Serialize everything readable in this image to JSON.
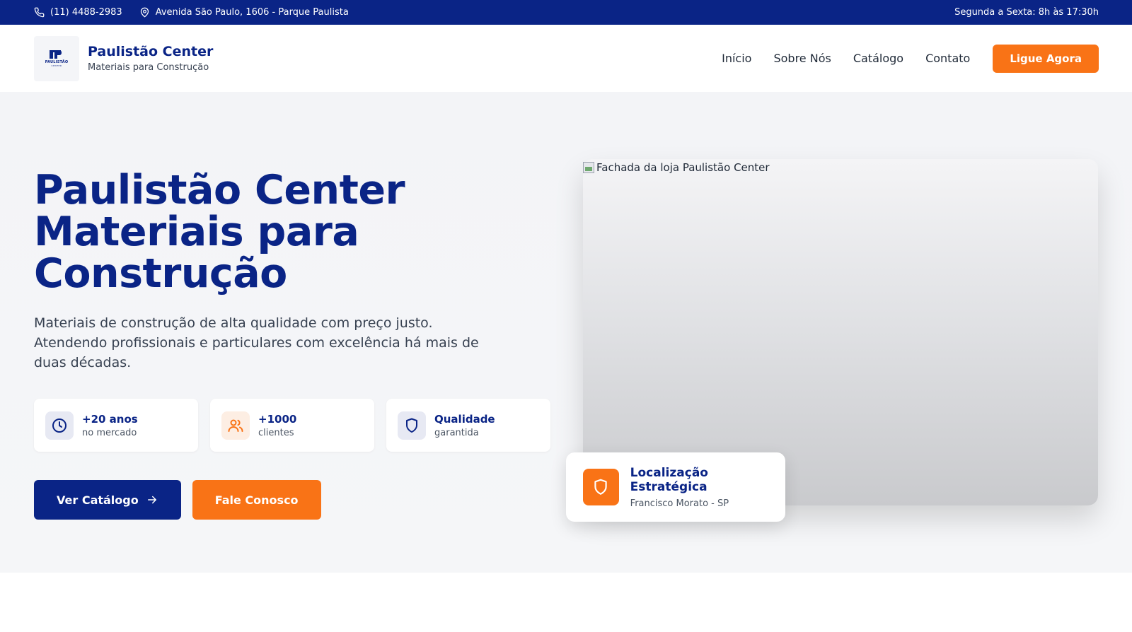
{
  "topbar": {
    "phone": "(11) 4488-2983",
    "address": "Avenida São Paulo, 1606 - Parque Paulista",
    "hours": "Segunda a Sexta: 8h às 17:30h"
  },
  "brand": {
    "logo_text": "PAULISTÃO",
    "logo_subtext": "CENTER",
    "title": "Paulistão Center",
    "subtitle": "Materiais para Construção"
  },
  "nav": {
    "items": [
      "Início",
      "Sobre Nós",
      "Catálogo",
      "Contato"
    ],
    "cta": "Ligue Agora"
  },
  "hero": {
    "title_line1": "Paulistão Center",
    "title_line2": "Materiais para",
    "title_line3": "Construção",
    "description": "Materiais de construção de alta qualidade com preço justo. Atendendo profissionais e particulares com excelência há mais de duas décadas.",
    "stats": [
      {
        "value": "+20 anos",
        "label": "no mercado",
        "icon": "clock-icon"
      },
      {
        "value": "+1000",
        "label": "clientes",
        "icon": "users-icon"
      },
      {
        "value": "Qualidade",
        "label": "garantida",
        "icon": "shield-icon"
      }
    ],
    "primary_cta": "Ver Catálogo",
    "secondary_cta": "Fale Conosco",
    "image_alt": "Fachada da loja Paulistão Center",
    "location": {
      "title": "Localização Estratégica",
      "subtitle": "Francisco Morato - SP"
    }
  },
  "colors": {
    "primary": "#0a2486",
    "accent": "#f97316"
  }
}
